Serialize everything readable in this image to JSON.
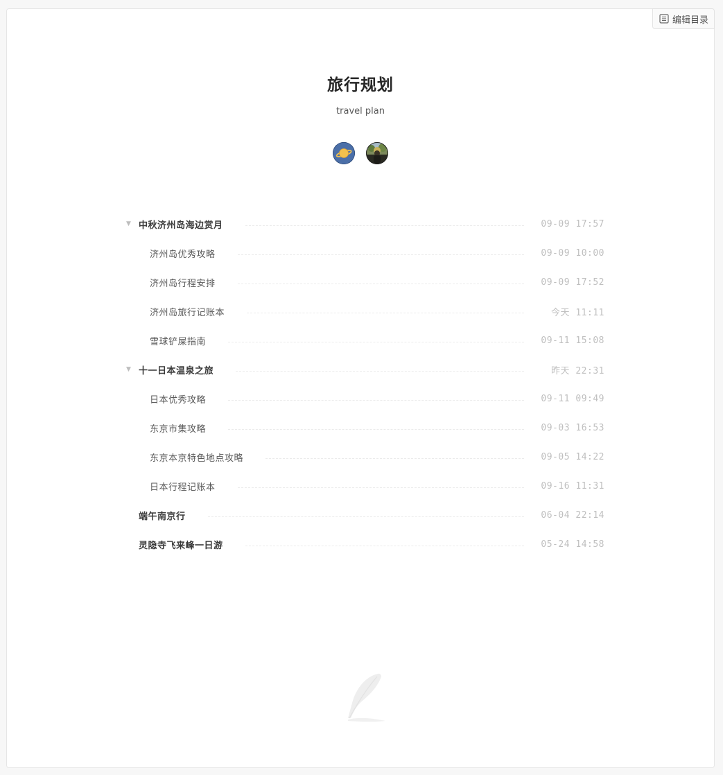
{
  "header": {
    "edit_toc_label": "编辑目录",
    "title": "旅行规划",
    "subtitle": "travel plan"
  },
  "avatars": [
    {
      "icon": "planet-icon",
      "bg": "#4a6fa5"
    },
    {
      "icon": "photo-avatar",
      "bg": "#2c2a22"
    }
  ],
  "toc": [
    {
      "label": "中秋济州岛海边赏月",
      "time": "09-09 17:57",
      "level": 0,
      "expandable": true
    },
    {
      "label": "济州岛优秀攻略",
      "time": "09-09 10:00",
      "level": 1
    },
    {
      "label": "济州岛行程安排",
      "time": "09-09 17:52",
      "level": 1
    },
    {
      "label": "济州岛旅行记账本",
      "time": "今天 11:11",
      "level": 1
    },
    {
      "label": "雪球铲屎指南",
      "time": "09-11 15:08",
      "level": 1
    },
    {
      "label": "十一日本温泉之旅",
      "time": "昨天 22:31",
      "level": 0,
      "expandable": true
    },
    {
      "label": "日本优秀攻略",
      "time": "09-11 09:49",
      "level": 1
    },
    {
      "label": "东京市集攻略",
      "time": "09-03 16:53",
      "level": 1
    },
    {
      "label": "东京本京特色地点攻略",
      "time": "09-05 14:22",
      "level": 1
    },
    {
      "label": "日本行程记账本",
      "time": "09-16 11:31",
      "level": 1
    },
    {
      "label": "端午南京行",
      "time": "06-04 22:14",
      "level": 0,
      "expandable": false
    },
    {
      "label": "灵隐寺飞来峰一日游",
      "time": "05-24 14:58",
      "level": 0,
      "expandable": false
    }
  ],
  "colors": {
    "accent_text": "#262626",
    "muted": "#bfbfbf"
  }
}
